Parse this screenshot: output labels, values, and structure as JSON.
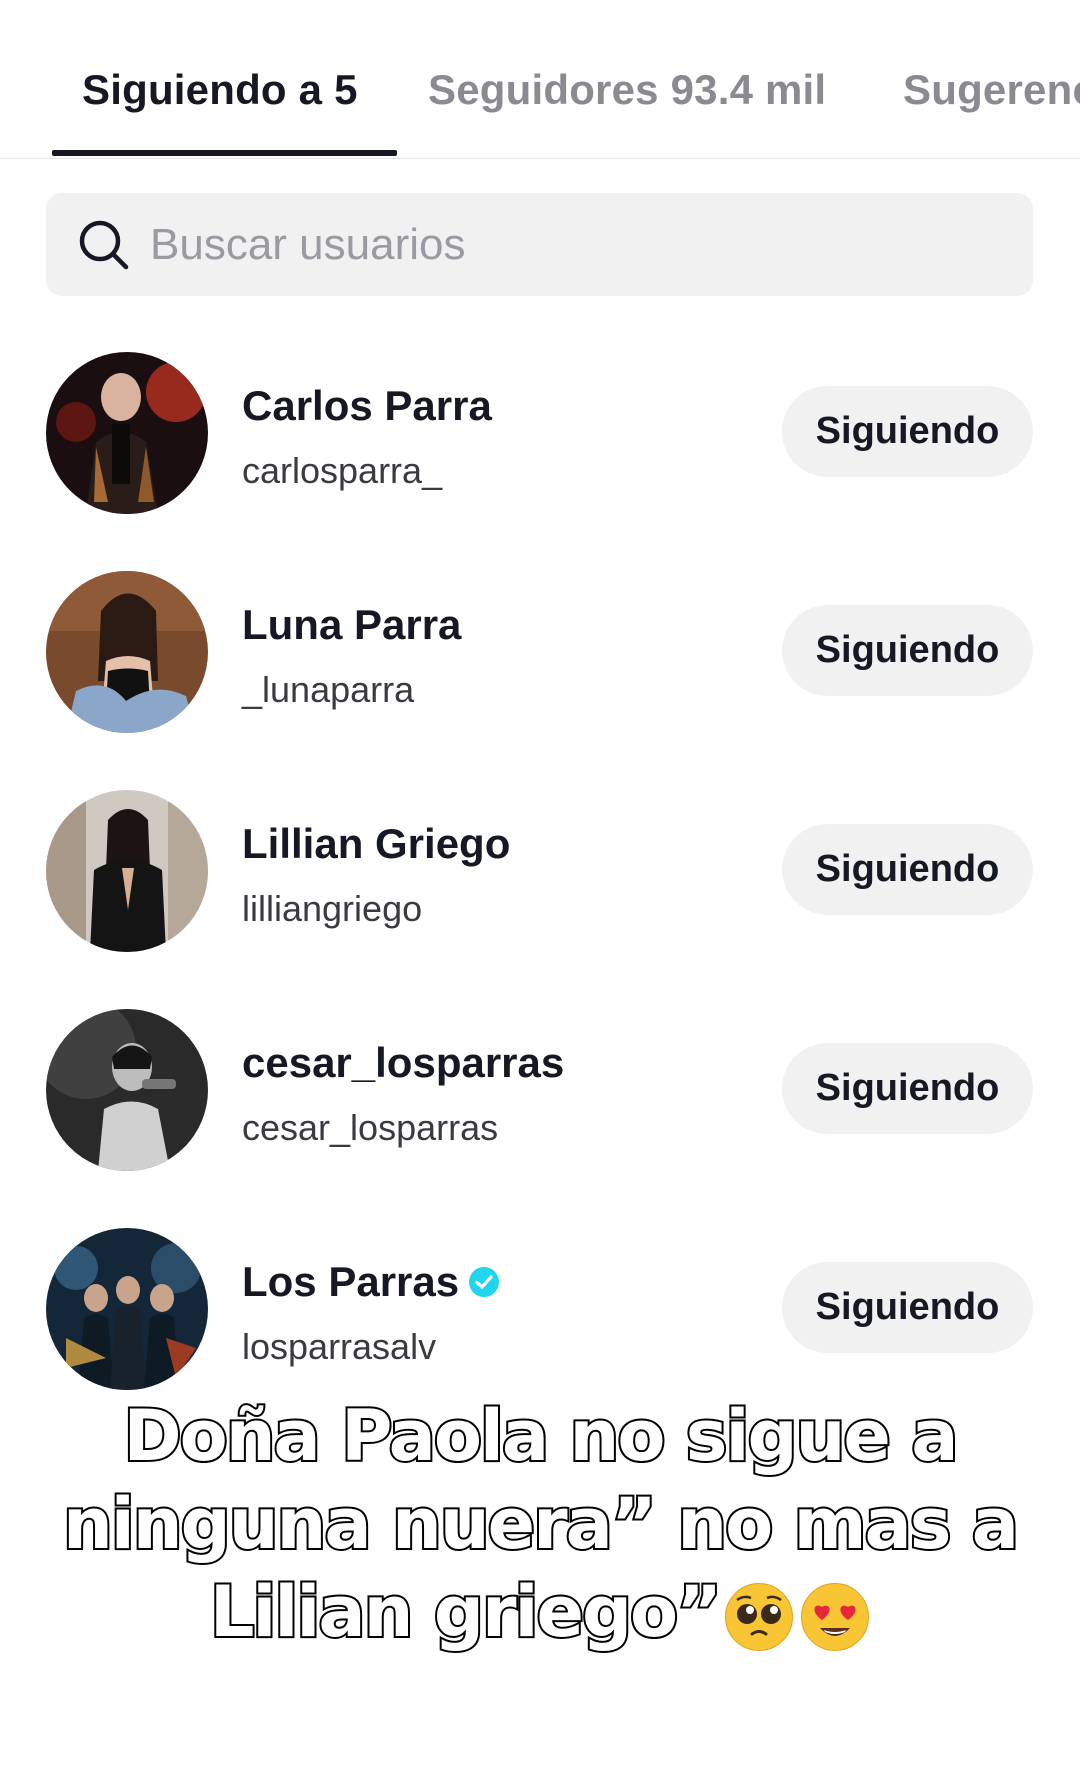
{
  "tabs": [
    {
      "label": "Siguiendo a 5",
      "active": true
    },
    {
      "label": "Seguidores 93.4 mil",
      "active": false
    },
    {
      "label": "Sugerencias",
      "active": false
    }
  ],
  "search": {
    "placeholder": "Buscar usuarios",
    "icon": "search-icon"
  },
  "users": [
    {
      "name": "Carlos Parra",
      "handle": "carlosparra_",
      "button": "Siguiendo",
      "verified": false
    },
    {
      "name": "Luna Parra",
      "handle": "_lunaparra",
      "button": "Siguiendo",
      "verified": false
    },
    {
      "name": "Lillian Griego",
      "handle": "lilliangriego",
      "button": "Siguiendo",
      "verified": false
    },
    {
      "name": "cesar_losparras",
      "handle": "cesar_losparras",
      "button": "Siguiendo",
      "verified": false
    },
    {
      "name": "Los Parras",
      "handle": "losparrasalv",
      "button": "Siguiendo",
      "verified": true
    }
  ],
  "caption": {
    "line1": "Doña Paola no sigue a",
    "line2": "ninguna nuera” no mas a",
    "line3": "Lilian griego”",
    "emojis": [
      "pleading-face-emoji",
      "heart-eyes-emoji"
    ]
  },
  "colors": {
    "text": "#161823",
    "inactive": "#8a8b91",
    "button_bg": "#f1f1f2",
    "verified": "#20d5ec"
  }
}
